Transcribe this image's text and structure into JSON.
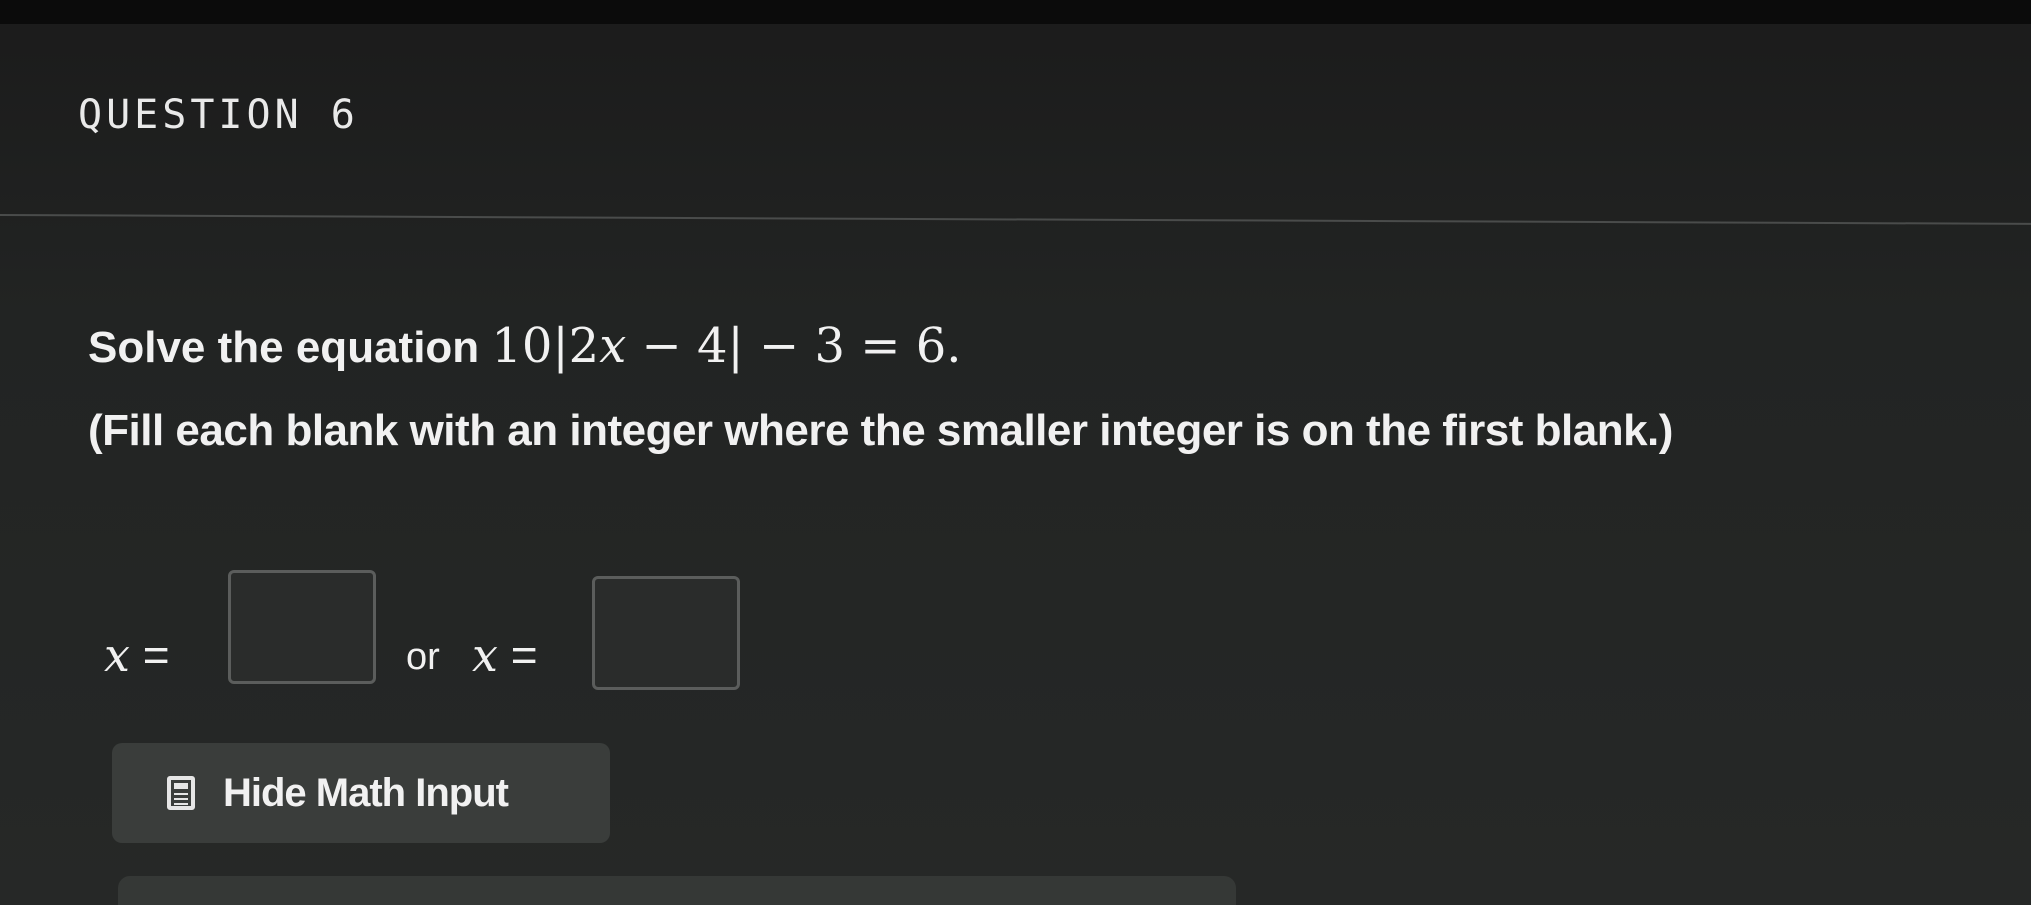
{
  "question": {
    "heading": "QUESTION 6",
    "prompt": {
      "intro": "Solve the equation ",
      "equation_coef": "10",
      "equation_abs_open": "|",
      "equation_inner_coef": "2",
      "equation_var": "x",
      "equation_inner_rest": " − 4",
      "equation_abs_close": "|",
      "equation_rest": " − 3 = 6",
      "period": "."
    },
    "instructions": "(Fill each blank with an integer where the smaller integer is on the first blank.)"
  },
  "answer": {
    "var_symbol": "x",
    "equals": " =",
    "connector": "or",
    "blank_1_value": "",
    "blank_2_value": ""
  },
  "controls": {
    "hide_math_label": "Hide Math Input",
    "hide_math_icon": "calculator-icon"
  },
  "colors": {
    "background": "#222423",
    "text": "#f1f1f1",
    "button_bg": "#3a3d3b",
    "blank_border": "#5b5d5c"
  }
}
